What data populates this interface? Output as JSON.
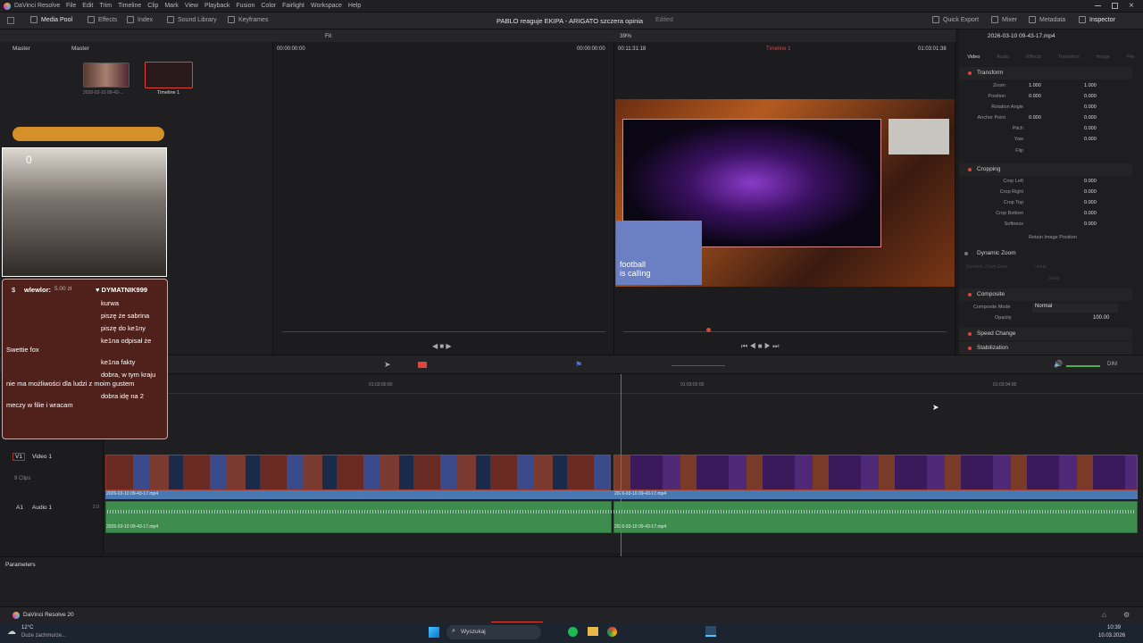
{
  "app": {
    "name": "DaVinci Resolve"
  },
  "menu": [
    "File",
    "Edit",
    "Trim",
    "Timeline",
    "Clip",
    "Mark",
    "View",
    "Playback",
    "Fusion",
    "Color",
    "Fairlight",
    "Workspace",
    "Help"
  ],
  "project": {
    "title": "PABLO reaguje EKIPA - ARIGATO szczera opinia",
    "status": "Edited"
  },
  "toolbar": {
    "left": [
      "Media Pool",
      "Effects",
      "Index",
      "Sound Library",
      "Keyframes"
    ],
    "right": [
      "Quick Export",
      "Mixer",
      "Metadata",
      "Inspector"
    ]
  },
  "media_pool": {
    "bin": "Master",
    "crumb": "Master",
    "items": [
      {
        "label": "2026-03-10 09-43-..."
      },
      {
        "label": "Timeline 1"
      }
    ]
  },
  "source_viewer": {
    "zoom": "Fit",
    "tc_left": "00:00:00:00",
    "tc_right": "00:00:00:00"
  },
  "timeline_viewer": {
    "zoom": "39%",
    "tc_left": "00:11:31:18",
    "timeline_name": "Timeline 1",
    "tc_right": "01:03:01:38"
  },
  "video_overlay": {
    "ad_line1": "football",
    "ad_line2": "is calling"
  },
  "inspector": {
    "clip_name": "2026-03-10 09-43-17.mp4",
    "tabs": [
      "Video",
      "Audio",
      "Effects",
      "Transition",
      "Image",
      "File"
    ],
    "transform": {
      "title": "Transform",
      "rows": [
        {
          "label": "Zoom",
          "x": "1.000",
          "y": "1.000"
        },
        {
          "label": "Position",
          "x": "0.000",
          "y": "0.000"
        },
        {
          "label": "Rotation Angle",
          "v": "0.000"
        },
        {
          "label": "Anchor Point",
          "x": "0.000",
          "y": "0.000"
        },
        {
          "label": "Pitch",
          "v": "0.000"
        },
        {
          "label": "Yaw",
          "v": "0.000"
        },
        {
          "label": "Flip"
        }
      ]
    },
    "cropping": {
      "title": "Cropping",
      "rows": [
        {
          "label": "Crop Left",
          "v": "0.000"
        },
        {
          "label": "Crop Right",
          "v": "0.000"
        },
        {
          "label": "Crop Top",
          "v": "0.000"
        },
        {
          "label": "Crop Bottom",
          "v": "0.000"
        },
        {
          "label": "Softness",
          "v": "0.000"
        }
      ],
      "retain": "Retain Image Position"
    },
    "dynamic_zoom": {
      "title": "Dynamic Zoom",
      "ease_label": "Dynamic Zoom Ease",
      "ease_value": "Linear",
      "swap": "Swap"
    },
    "composite": {
      "title": "Composite",
      "mode_label": "Composite Mode",
      "mode_value": "Normal",
      "opacity_label": "Opacity",
      "opacity_value": "100.00"
    },
    "speed_change": "Speed Change",
    "stabilization": "Stabilization"
  },
  "timeline": {
    "ruler": [
      "01:03:00:00",
      "01:03:02:00",
      "01:03:04:00"
    ],
    "video_track": {
      "id": "V1",
      "name": "Video 1",
      "clips_count": "9 Clips",
      "clip_label": "2026-03-10 09-43-17.mp4"
    },
    "audio_track": {
      "id": "A1",
      "name": "Audio 1",
      "channels": "2.0",
      "clip_label": "2026-03-10 09-43-17.mp4"
    },
    "volume_label": "DIM"
  },
  "stream_overlay": {
    "bar_text": "",
    "cam_counter": "0",
    "donor_prefix": "$",
    "donor_name": "wlewlor:",
    "donor_amount": "5.00 zł",
    "donor2": "♥ DYMATNIK999",
    "chat": [
      {
        "user": "",
        "msg": "kurwa"
      },
      {
        "user": "",
        "msg": "piszę że sabrina"
      },
      {
        "user": "",
        "msg": "piszę do ke1ny"
      },
      {
        "user": "",
        "msg": "ke1na odpisał że Swettie fox"
      },
      {
        "user": "",
        "msg": "ke1na fakty"
      },
      {
        "user": "",
        "msg": "dobra, w tym kraju nie ma możliwości dla ludzi z moim gustem"
      },
      {
        "user": "",
        "msg": "dobra idę na 2 meczy w filie i wracam"
      }
    ]
  },
  "parameters_label": "Parameters",
  "footer": {
    "brand": "DaVinci Resolve 20"
  },
  "taskbar": {
    "weather_temp": "12°C",
    "weather_desc": "Duże zachmurze...",
    "search": "Wyszukaj",
    "time": "10:39",
    "date": "10.03.2026"
  },
  "colors": {
    "accent_red": "#e0443a",
    "audio_green": "#3e8c4e",
    "clip_blue": "#4a78b0",
    "playhead": "#e0443a"
  }
}
